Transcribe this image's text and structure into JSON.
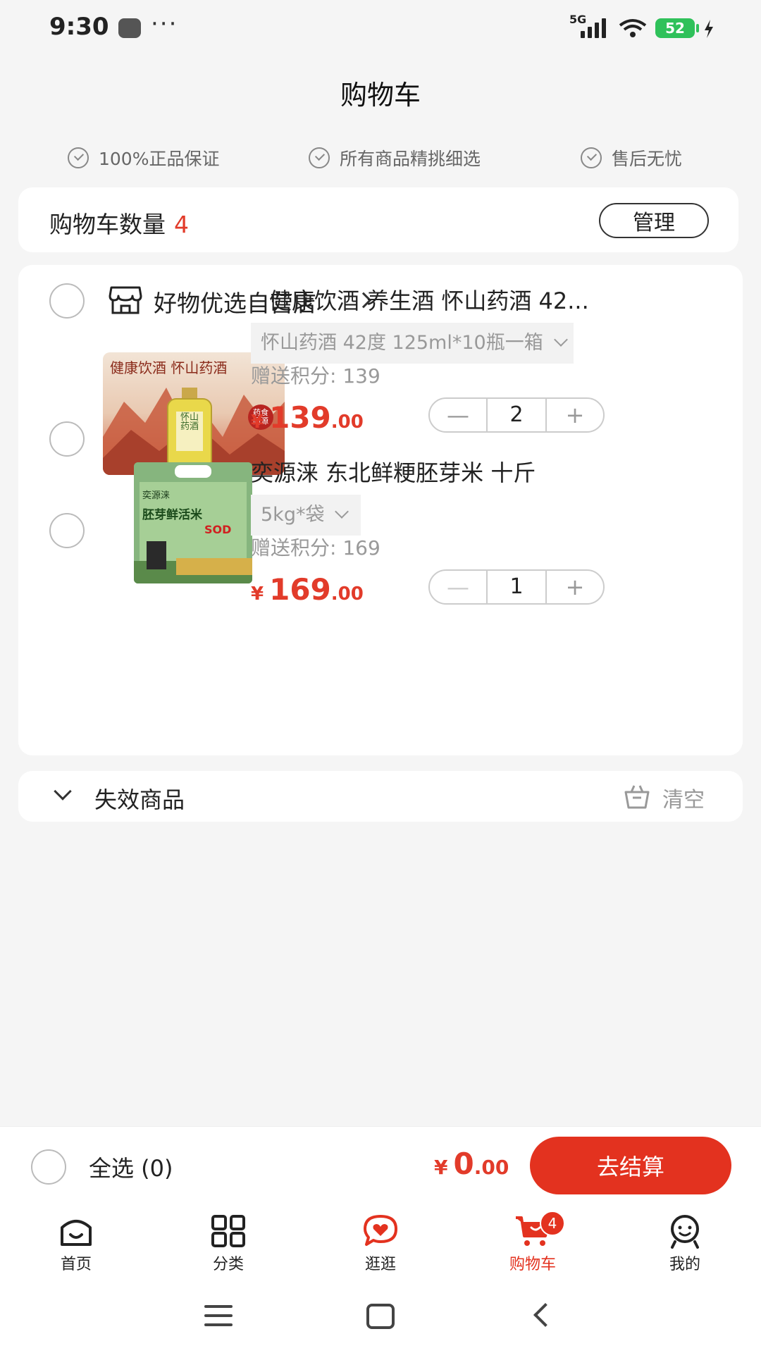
{
  "status_bar": {
    "time": "9:30",
    "dots": "···",
    "network": "5G",
    "battery": "52"
  },
  "page": {
    "title": "购物车"
  },
  "guarantees": [
    "100%正品保证",
    "所有商品精挑细选",
    "售后无忧"
  ],
  "cart_summary": {
    "label": "购物车数量",
    "count": "4",
    "manage_label": "管理"
  },
  "store": {
    "name": "好物优选自营店",
    "products": [
      {
        "title": "健康饮酒 养生酒 怀山药酒 42...",
        "spec": "怀山药酒 42度 125ml*10瓶一箱",
        "points": "赠送积分: 139",
        "price_symbol": "¥",
        "price_int": "139",
        "price_dec": ".00",
        "quantity": "2",
        "image_text_top": "健康饮酒 怀山药酒",
        "image_text_bottle": "怀山药酒",
        "image_text_seal": "药食同源"
      },
      {
        "title": "奕源涞 东北鲜粳胚芽米 十斤",
        "spec": "5kg*袋",
        "points": "赠送积分: 169",
        "price_symbol": "¥",
        "price_int": "169",
        "price_dec": ".00",
        "quantity": "1",
        "image_text_brand": "奕源涞",
        "image_text_name": "胚芽鲜活米",
        "image_text_sub": "SOD"
      }
    ],
    "minus": "—",
    "plus": "+"
  },
  "invalid_section": {
    "label": "失效商品",
    "clear_label": "清空"
  },
  "checkout": {
    "select_all": "全选 (0)",
    "total_symbol": "¥",
    "total_int": "0",
    "total_dec": ".00",
    "button_label": "去结算"
  },
  "tabs": [
    {
      "label": "首页"
    },
    {
      "label": "分类"
    },
    {
      "label": "逛逛"
    },
    {
      "label": "购物车",
      "badge": "4"
    },
    {
      "label": "我的"
    }
  ],
  "colors": {
    "accent": "#e3321f",
    "price": "#e23b2a",
    "background": "#f5f5f5"
  }
}
